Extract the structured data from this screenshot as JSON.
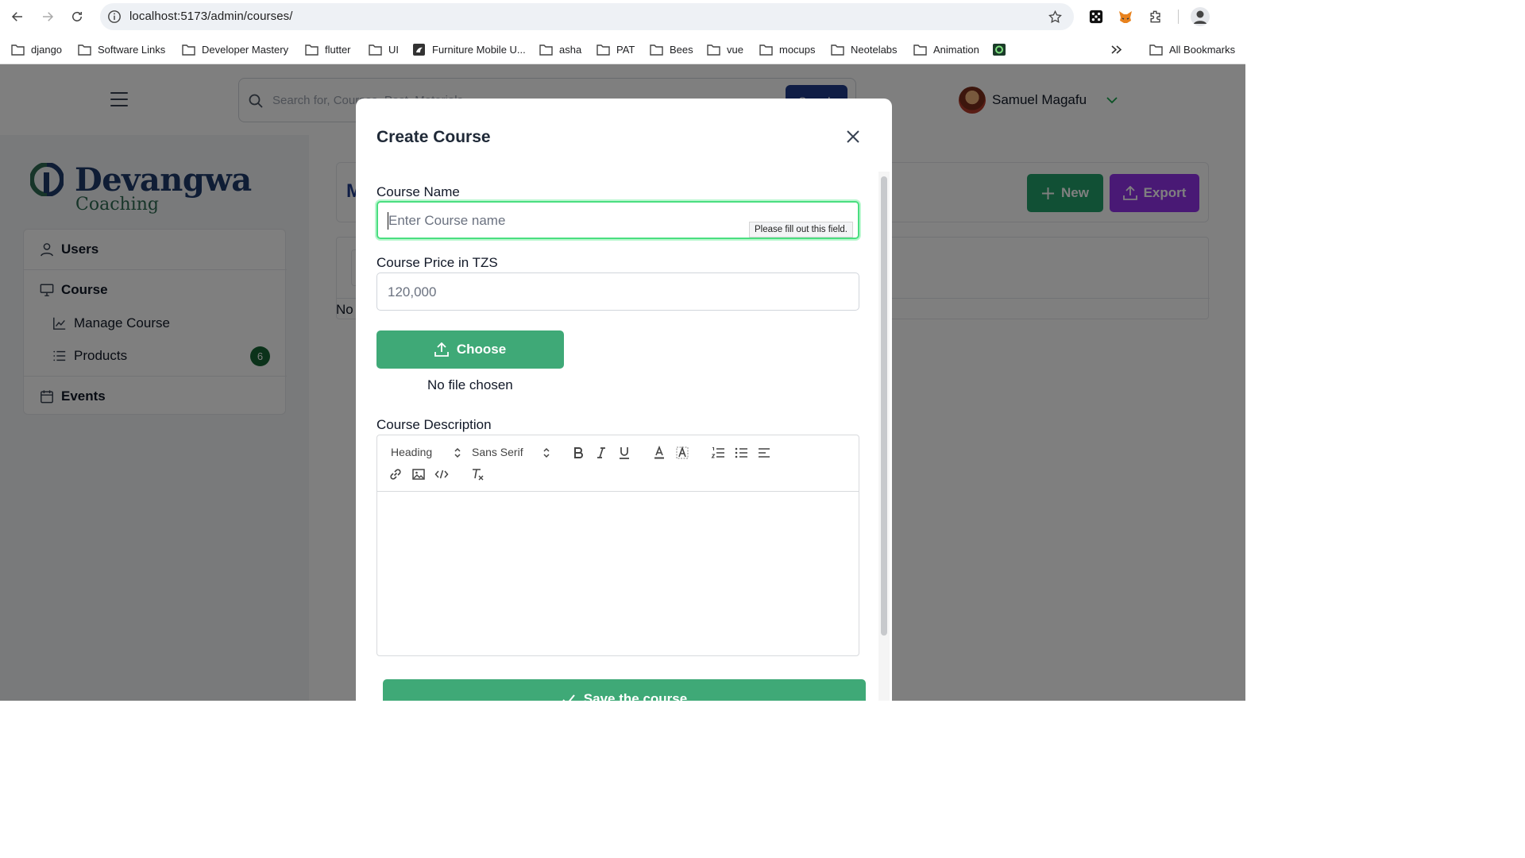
{
  "browser": {
    "url": "localhost:5173/admin/courses/",
    "bookmarks": [
      {
        "label": "django",
        "icon": "folder-icon"
      },
      {
        "label": "Software Links",
        "icon": "folder-icon"
      },
      {
        "label": "Developer Mastery",
        "icon": "folder-icon"
      },
      {
        "label": "flutter",
        "icon": "folder-icon"
      },
      {
        "label": "UI",
        "icon": "folder-icon"
      },
      {
        "label": "Furniture Mobile U...",
        "icon": "site-icon"
      },
      {
        "label": "asha",
        "icon": "folder-icon"
      },
      {
        "label": "PAT",
        "icon": "folder-icon"
      },
      {
        "label": "Bees",
        "icon": "folder-icon"
      },
      {
        "label": "vue",
        "icon": "folder-icon"
      },
      {
        "label": "mocups",
        "icon": "folder-icon"
      },
      {
        "label": "Neotelabs",
        "icon": "folder-icon"
      },
      {
        "label": "Animation",
        "icon": "folder-icon"
      }
    ],
    "all_bookmarks": "All Bookmarks"
  },
  "header": {
    "search_placeholder": "Search for, Courses, Post, Materials",
    "search_button": "Search",
    "user_name": "Samuel Magafu"
  },
  "brand": {
    "name": "Devangwa",
    "tagline": "Coaching"
  },
  "sidebar": {
    "users": "Users",
    "course": "Course",
    "manage_course": "Manage Course",
    "products": "Products",
    "products_count": "6",
    "events": "Events"
  },
  "page": {
    "title": "M",
    "new_button": "New",
    "export_button": "Export",
    "empty_text": "No"
  },
  "modal": {
    "title": "Create Course",
    "course_name_label": "Course Name",
    "course_name_placeholder": "Enter Course name",
    "validation_tooltip": "Please fill out this field.",
    "price_label": "Course Price in TZS",
    "price_placeholder": "120,000",
    "choose_button": "Choose",
    "file_status": "No file chosen",
    "description_label": "Course Description",
    "editor": {
      "heading_select": "Heading",
      "font_select": "Sans Serif"
    },
    "save_button": "Save the course"
  },
  "colors": {
    "primary_green": "#3fa977",
    "new_green": "#22a06b",
    "export_purple": "#9333ea",
    "badge_green": "#166534",
    "focus_ring": "#4ade80"
  }
}
